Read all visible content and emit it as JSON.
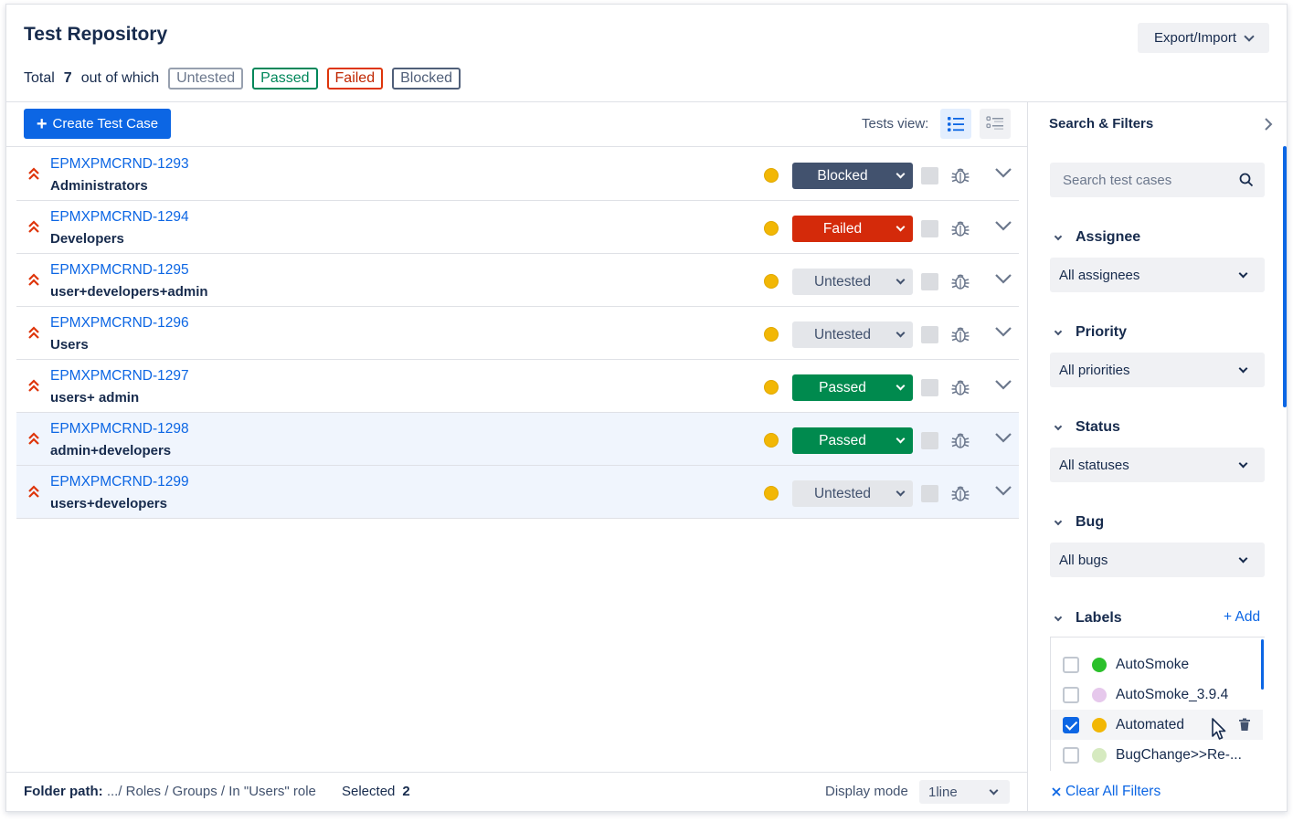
{
  "header": {
    "title": "Test Repository",
    "export_label": "Export/Import",
    "summary": {
      "total_prefix": "Total",
      "total_count": "7",
      "out_of_which": "out of which",
      "untested": "Untested",
      "passed": "Passed",
      "failed": "Failed",
      "blocked": "Blocked"
    }
  },
  "toolbar": {
    "create_label": "Create Test Case",
    "tests_view_label": "Tests view:"
  },
  "tests": [
    {
      "key": "EPMXPMCRND-1293",
      "name": "Administrators",
      "status": "Blocked",
      "status_class": "st-blocked",
      "selected": false
    },
    {
      "key": "EPMXPMCRND-1294",
      "name": "Developers",
      "status": "Failed",
      "status_class": "st-failed",
      "selected": false
    },
    {
      "key": "EPMXPMCRND-1295",
      "name": "user+developers+admin",
      "status": "Untested",
      "status_class": "st-untested",
      "selected": false
    },
    {
      "key": "EPMXPMCRND-1296",
      "name": "Users",
      "status": "Untested",
      "status_class": "st-untested",
      "selected": false
    },
    {
      "key": "EPMXPMCRND-1297",
      "name": "users+ admin",
      "status": "Passed",
      "status_class": "st-passed",
      "selected": false
    },
    {
      "key": "EPMXPMCRND-1298",
      "name": "admin+developers",
      "status": "Passed",
      "status_class": "st-passed",
      "selected": true
    },
    {
      "key": "EPMXPMCRND-1299",
      "name": "users+developers",
      "status": "Untested",
      "status_class": "st-untested",
      "selected": true
    }
  ],
  "footer": {
    "folder_path_label": "Folder path:",
    "folder_path_value": ".../ Roles / Groups / In \"Users\" role",
    "selected_label": "Selected",
    "selected_count": "2",
    "display_mode_label": "Display mode",
    "display_mode_value": "1line"
  },
  "filters": {
    "title": "Search & Filters",
    "search_placeholder": "Search test cases",
    "assignee": {
      "heading": "Assignee",
      "value": "All assignees"
    },
    "priority": {
      "heading": "Priority",
      "value": "All priorities"
    },
    "status": {
      "heading": "Status",
      "value": "All statuses"
    },
    "bug": {
      "heading": "Bug",
      "value": "All bugs"
    },
    "labels": {
      "heading": "Labels",
      "add_label": "Add",
      "items": [
        {
          "name": "AutoSmoke",
          "color": "#2bc02b",
          "checked": false
        },
        {
          "name": "AutoSmoke_3.9.4",
          "color": "#e6c8ec",
          "checked": false
        },
        {
          "name": "Automated",
          "color": "#f2b705",
          "checked": true
        },
        {
          "name": "BugChange>>Re-...",
          "color": "#d6eac0",
          "checked": false
        }
      ]
    },
    "clear_all_label": "Clear All Filters"
  },
  "colors": {
    "accent": "#0c66e4",
    "priority_icon": "#de350b",
    "priority_dot": "#f2b705"
  }
}
